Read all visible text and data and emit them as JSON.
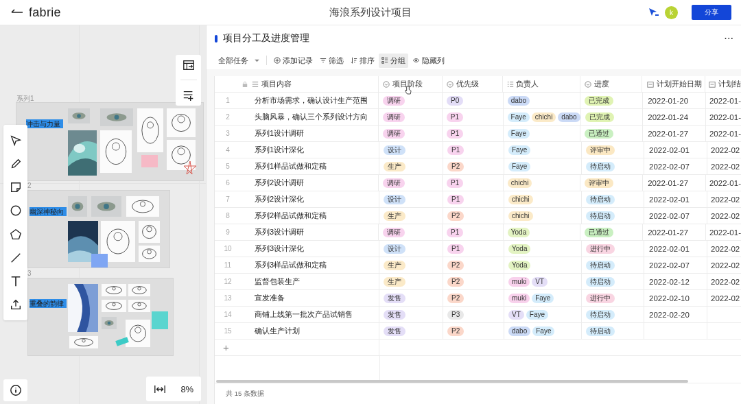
{
  "header": {
    "logo": "fabrie",
    "title": "海浪系列设计项目",
    "avatar": "k",
    "share": "分享"
  },
  "canvas": {
    "boards": [
      {
        "label": "系列1",
        "title": "冲击与力量"
      },
      {
        "label": "2",
        "title": "幽深神秘向"
      },
      {
        "label": "3",
        "title": "重叠的韵律"
      }
    ],
    "zoom": "8%"
  },
  "table": {
    "title": "项目分工及进度管理",
    "more": "···",
    "view": "全部任务",
    "actions": [
      {
        "label": "添加记录",
        "kind": "add",
        "selected": false
      },
      {
        "label": "筛选",
        "kind": "filter",
        "selected": false
      },
      {
        "label": "排序",
        "kind": "sort",
        "selected": false
      },
      {
        "label": "分组",
        "kind": "group",
        "selected": true
      },
      {
        "label": "隐藏列",
        "kind": "eye",
        "selected": false
      }
    ],
    "columns": [
      {
        "label": "项目内容",
        "kind": "text"
      },
      {
        "label": "项目阶段",
        "kind": "select"
      },
      {
        "label": "优先级",
        "kind": "select"
      },
      {
        "label": "负责人",
        "kind": "multi"
      },
      {
        "label": "进度",
        "kind": "select"
      },
      {
        "label": "计划开始日期",
        "kind": "date"
      },
      {
        "label": "计划结",
        "kind": "date"
      }
    ],
    "rows": [
      {
        "index": "1",
        "content": "分析市场需求，确认设计生产范围",
        "stage": {
          "label": "调研",
          "color": "#f8d3ee"
        },
        "priority": {
          "label": "P0",
          "color": "#e3ddf7"
        },
        "owners": [
          {
            "label": "dabo",
            "color": "#cbdaf6"
          }
        ],
        "progress": {
          "label": "已完成",
          "color": "#e0f3b3"
        },
        "start": "2022-01-20",
        "end": "2022-01-"
      },
      {
        "index": "2",
        "content": "头脑风暴，确认三个系列设计方向",
        "stage": {
          "label": "调研",
          "color": "#f8d3ee"
        },
        "priority": {
          "label": "P1",
          "color": "#f8d3ee"
        },
        "owners": [
          {
            "label": "Faye",
            "color": "#d4ecfb"
          },
          {
            "label": "chichi",
            "color": "#fbeac8"
          },
          {
            "label": "dabo",
            "color": "#cbdaf6"
          }
        ],
        "progress": {
          "label": "已完成",
          "color": "#e0f3b3"
        },
        "start": "2022-01-24",
        "end": "2022-01-"
      },
      {
        "index": "3",
        "content": "系列1设计调研",
        "stage": {
          "label": "调研",
          "color": "#f8d3ee"
        },
        "priority": {
          "label": "P1",
          "color": "#f8d3ee"
        },
        "owners": [
          {
            "label": "Faye",
            "color": "#d4ecfb"
          }
        ],
        "progress": {
          "label": "已通过",
          "color": "#c9f0c1"
        },
        "start": "2022-01-27",
        "end": "2022-01-"
      },
      {
        "index": "4",
        "content": "系列1设计深化",
        "stage": {
          "label": "设计",
          "color": "#cfe1f8"
        },
        "priority": {
          "label": "P1",
          "color": "#f8d3ee"
        },
        "owners": [
          {
            "label": "Faye",
            "color": "#d4ecfb"
          }
        ],
        "progress": {
          "label": "评审中",
          "color": "#fbe8c3"
        },
        "start": "2022-02-01",
        "end": "2022-02"
      },
      {
        "index": "5",
        "content": "系列1样品试做和定稿",
        "stage": {
          "label": "生产",
          "color": "#fbeac8"
        },
        "priority": {
          "label": "P2",
          "color": "#fbd7c9"
        },
        "owners": [
          {
            "label": "Faye",
            "color": "#d4ecfb"
          }
        ],
        "progress": {
          "label": "待启动",
          "color": "#d4ecfb"
        },
        "start": "2022-02-07",
        "end": "2022-02"
      },
      {
        "index": "6",
        "content": "系列2设计调研",
        "stage": {
          "label": "调研",
          "color": "#f8d3ee"
        },
        "priority": {
          "label": "P1",
          "color": "#f8d3ee"
        },
        "owners": [
          {
            "label": "chichi",
            "color": "#fbeac8"
          }
        ],
        "progress": {
          "label": "评审中",
          "color": "#fbe8c3"
        },
        "start": "2022-01-27",
        "end": "2022-01-"
      },
      {
        "index": "7",
        "content": "系列2设计深化",
        "stage": {
          "label": "设计",
          "color": "#cfe1f8"
        },
        "priority": {
          "label": "P1",
          "color": "#f8d3ee"
        },
        "owners": [
          {
            "label": "chichi",
            "color": "#fbeac8"
          }
        ],
        "progress": {
          "label": "待启动",
          "color": "#d4ecfb"
        },
        "start": "2022-02-01",
        "end": "2022-02"
      },
      {
        "index": "8",
        "content": "系列2样品试做和定稿",
        "stage": {
          "label": "生产",
          "color": "#fbeac8"
        },
        "priority": {
          "label": "P2",
          "color": "#fbd7c9"
        },
        "owners": [
          {
            "label": "chichi",
            "color": "#fbeac8"
          }
        ],
        "progress": {
          "label": "待启动",
          "color": "#d4ecfb"
        },
        "start": "2022-02-07",
        "end": "2022-02"
      },
      {
        "index": "9",
        "content": "系列3设计调研",
        "stage": {
          "label": "调研",
          "color": "#f8d3ee"
        },
        "priority": {
          "label": "P1",
          "color": "#f8d3ee"
        },
        "owners": [
          {
            "label": "Yoda",
            "color": "#e3f3c2"
          }
        ],
        "progress": {
          "label": "已通过",
          "color": "#c9f0c1"
        },
        "start": "2022-01-27",
        "end": "2022-01-"
      },
      {
        "index": "10",
        "content": "系列3设计深化",
        "stage": {
          "label": "设计",
          "color": "#cfe1f8"
        },
        "priority": {
          "label": "P1",
          "color": "#f8d3ee"
        },
        "owners": [
          {
            "label": "Yoda",
            "color": "#e3f3c2"
          }
        ],
        "progress": {
          "label": "进行中",
          "color": "#f9d5e2"
        },
        "start": "2022-02-01",
        "end": "2022-02"
      },
      {
        "index": "11",
        "content": "系列3样品试做和定稿",
        "stage": {
          "label": "生产",
          "color": "#fbeac8"
        },
        "priority": {
          "label": "P2",
          "color": "#fbd7c9"
        },
        "owners": [
          {
            "label": "Yoda",
            "color": "#e3f3c2"
          }
        ],
        "progress": {
          "label": "待启动",
          "color": "#d4ecfb"
        },
        "start": "2022-02-07",
        "end": "2022-02"
      },
      {
        "index": "12",
        "content": "监督包装生产",
        "stage": {
          "label": "生产",
          "color": "#fbeac8"
        },
        "priority": {
          "label": "P2",
          "color": "#fbd7c9"
        },
        "owners": [
          {
            "label": "muki",
            "color": "#f8d1ec"
          },
          {
            "label": "VT",
            "color": "#e4def7"
          }
        ],
        "progress": {
          "label": "待启动",
          "color": "#d4ecfb"
        },
        "start": "2022-02-12",
        "end": "2022-02"
      },
      {
        "index": "13",
        "content": "宣发准备",
        "stage": {
          "label": "发售",
          "color": "#e4def7"
        },
        "priority": {
          "label": "P2",
          "color": "#fbd7c9"
        },
        "owners": [
          {
            "label": "muki",
            "color": "#f8d1ec"
          },
          {
            "label": "Faye",
            "color": "#d4ecfb"
          }
        ],
        "progress": {
          "label": "进行中",
          "color": "#f9d5e2"
        },
        "start": "2022-02-10",
        "end": "2022-02"
      },
      {
        "index": "14",
        "content": "商铺上线第一批次产品试销售",
        "stage": {
          "label": "发售",
          "color": "#e4def7"
        },
        "priority": {
          "label": "P3",
          "color": "#e8e8e8"
        },
        "owners": [
          {
            "label": "VT",
            "color": "#e4def7"
          },
          {
            "label": "Faye",
            "color": "#d4ecfb"
          }
        ],
        "progress": {
          "label": "待启动",
          "color": "#d4ecfb"
        },
        "start": "2022-02-20"
      },
      {
        "index": "15",
        "content": "确认生产计划",
        "stage": {
          "label": "发售",
          "color": "#e4def7"
        },
        "priority": {
          "label": "P2",
          "color": "#fbd7c9"
        },
        "owners": [
          {
            "label": "dabo",
            "color": "#cbdaf6"
          },
          {
            "label": "Faye",
            "color": "#d4ecfb"
          }
        ],
        "progress": {
          "label": "待启动",
          "color": "#d4ecfb"
        }
      }
    ],
    "add_row": "+",
    "footer": "共 15 条数据"
  }
}
